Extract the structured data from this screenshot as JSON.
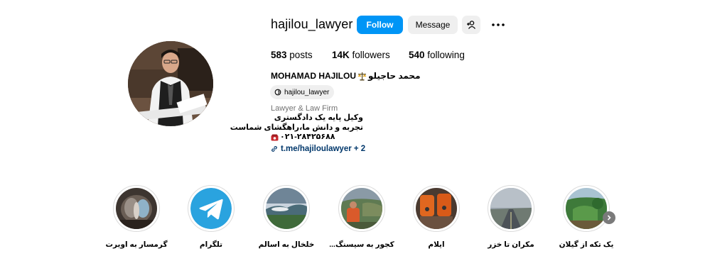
{
  "profile": {
    "username": "hajilou_lawyer",
    "follow_label": "Follow",
    "message_label": "Message",
    "add_user_icon": "add-user-icon",
    "more_icon": "more-icon",
    "posts_count": "583",
    "posts_label": "posts",
    "followers_count": "14K",
    "followers_label": "followers",
    "following_count": "540",
    "following_label": "following",
    "full_name_latin": "MOHAMAD HAJILOU",
    "full_name_farsi": "محمد حاجیلو",
    "threads_handle": "hajilou_lawyer",
    "category": "Lawyer & Law Firm",
    "bio_line1": "وکیل پایه یک دادگستری",
    "bio_line2": "تجربه و دانش ما،راهگشای شماست",
    "bio_phone": "۰۲۱-۲۸۴۲۵۶۸۸",
    "link_text": "t.me/hajiloulawyer + 2",
    "accent_color": "#0095f6"
  },
  "highlights": [
    {
      "label": "گرمسار به اویرت"
    },
    {
      "label": "تلگرام"
    },
    {
      "label": "خلخال به اسالم"
    },
    {
      "label": "کجور به سیسنگ..."
    },
    {
      "label": "ایلام"
    },
    {
      "label": "مکران تا خزر"
    },
    {
      "label": "یک تکه از گیلان"
    }
  ]
}
